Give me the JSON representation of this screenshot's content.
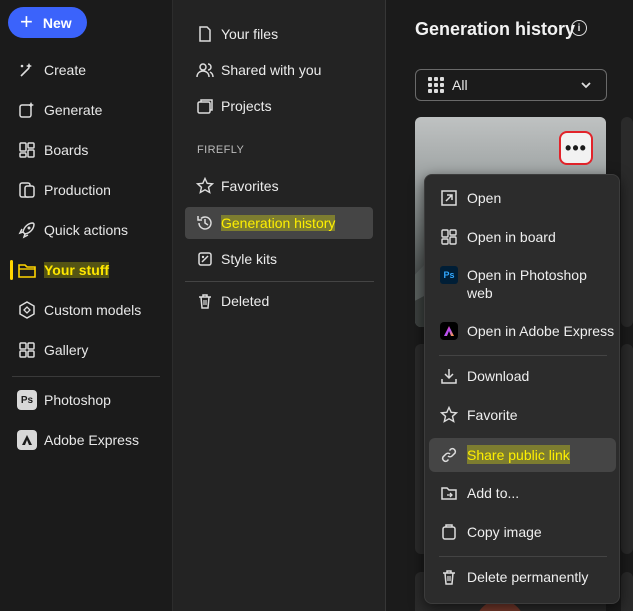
{
  "new_button": {
    "label": "New"
  },
  "left_nav": {
    "items": [
      {
        "label": "Create",
        "icon": "create-icon"
      },
      {
        "label": "Generate",
        "icon": "generate-icon"
      },
      {
        "label": "Boards",
        "icon": "boards-icon"
      },
      {
        "label": "Production",
        "icon": "production-icon"
      },
      {
        "label": "Quick actions",
        "icon": "rocket-icon"
      },
      {
        "label": "Your stuff",
        "icon": "folder-icon",
        "active": true
      },
      {
        "label": "Custom models",
        "icon": "custom-models-icon"
      },
      {
        "label": "Gallery",
        "icon": "gallery-icon"
      }
    ],
    "apps": [
      {
        "label": "Photoshop",
        "icon": "photoshop-icon",
        "badge": "Ps"
      },
      {
        "label": "Adobe Express",
        "icon": "adobe-express-icon"
      }
    ]
  },
  "mid_panel": {
    "top_items": [
      {
        "label": "Your files",
        "icon": "file-icon"
      },
      {
        "label": "Shared with you",
        "icon": "people-icon"
      },
      {
        "label": "Projects",
        "icon": "projects-icon"
      }
    ],
    "section_label": "FIREFLY",
    "firefly_items": [
      {
        "label": "Favorites",
        "icon": "star-icon"
      },
      {
        "label": "Generation history",
        "icon": "history-icon",
        "selected": true
      },
      {
        "label": "Style kits",
        "icon": "style-kit-icon"
      }
    ],
    "deleted": {
      "label": "Deleted",
      "icon": "trash-icon"
    }
  },
  "main": {
    "title": "Generation history",
    "filter": {
      "value": "All"
    },
    "more_button_label": "•••"
  },
  "context_menu": {
    "items": [
      {
        "label": "Open",
        "icon": "open-external-icon"
      },
      {
        "label": "Open in board",
        "icon": "board-icon"
      },
      {
        "label": "Open in Photoshop web",
        "icon": "photoshop-icon"
      },
      {
        "label": "Open in Adobe Express",
        "icon": "adobe-express-icon"
      },
      {
        "label": "Download",
        "icon": "download-icon"
      },
      {
        "label": "Favorite",
        "icon": "star-icon"
      },
      {
        "label": "Share public link",
        "icon": "link-icon",
        "hovered": true
      },
      {
        "label": "Add to...",
        "icon": "add-to-folder-icon"
      },
      {
        "label": "Copy image",
        "icon": "copy-image-icon"
      },
      {
        "label": "Delete permanently",
        "icon": "trash-icon"
      }
    ]
  },
  "colors": {
    "accent": "#3b63fb",
    "highlight": "#ffff00",
    "close_ring": "#e2232a"
  }
}
